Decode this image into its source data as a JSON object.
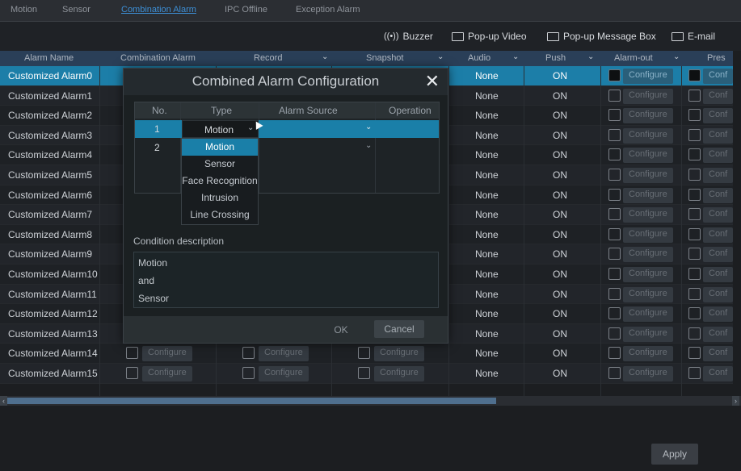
{
  "tabs": [
    {
      "label": "Motion",
      "active": false
    },
    {
      "label": "Sensor",
      "active": false
    },
    {
      "label": "Combination Alarm",
      "active": true
    },
    {
      "label": "IPC Offline",
      "active": false
    },
    {
      "label": "Exception Alarm",
      "active": false
    }
  ],
  "toolbar": {
    "buzzer": "Buzzer",
    "popup_video": "Pop-up Video",
    "popup_message": "Pop-up Message Box",
    "email": "E-mail"
  },
  "columns": {
    "alarm_name": "Alarm Name",
    "combination_alarm": "Combination Alarm",
    "record": "Record",
    "snapshot": "Snapshot",
    "audio": "Audio",
    "push": "Push",
    "alarm_out": "Alarm-out",
    "preset": "Pres"
  },
  "rows": [
    {
      "name": "Customized Alarm0",
      "audio": "None",
      "push": "ON"
    },
    {
      "name": "Customized Alarm1",
      "audio": "None",
      "push": "ON"
    },
    {
      "name": "Customized Alarm2",
      "audio": "None",
      "push": "ON"
    },
    {
      "name": "Customized Alarm3",
      "audio": "None",
      "push": "ON"
    },
    {
      "name": "Customized Alarm4",
      "audio": "None",
      "push": "ON"
    },
    {
      "name": "Customized Alarm5",
      "audio": "None",
      "push": "ON"
    },
    {
      "name": "Customized Alarm6",
      "audio": "None",
      "push": "ON"
    },
    {
      "name": "Customized Alarm7",
      "audio": "None",
      "push": "ON"
    },
    {
      "name": "Customized Alarm8",
      "audio": "None",
      "push": "ON"
    },
    {
      "name": "Customized Alarm9",
      "audio": "None",
      "push": "ON"
    },
    {
      "name": "Customized Alarm10",
      "audio": "None",
      "push": "ON"
    },
    {
      "name": "Customized Alarm11",
      "audio": "None",
      "push": "ON"
    },
    {
      "name": "Customized Alarm12",
      "audio": "None",
      "push": "ON"
    },
    {
      "name": "Customized Alarm13",
      "audio": "None",
      "push": "ON"
    },
    {
      "name": "Customized Alarm14",
      "audio": "None",
      "push": "ON"
    },
    {
      "name": "Customized Alarm15",
      "audio": "None",
      "push": "ON"
    }
  ],
  "configure_label": "Configure",
  "configure_truncated": "Conf",
  "apply_label": "Apply",
  "modal": {
    "title": "Combined Alarm Configuration",
    "close": "✕",
    "columns": {
      "no": "No.",
      "type": "Type",
      "alarm_source": "Alarm Source",
      "operation": "Operation"
    },
    "rows": [
      {
        "no": "1",
        "type": "Motion"
      },
      {
        "no": "2",
        "type": ""
      }
    ],
    "dropdown_options": [
      "Motion",
      "Sensor",
      "Face Recognition",
      "Intrusion",
      "Line Crossing"
    ],
    "condition_label": "Condition description",
    "condition_lines": [
      "Motion",
      "and",
      "Sensor"
    ],
    "ok_label": "OK",
    "cancel_label": "Cancel"
  },
  "colors": {
    "accent": "#1a7fa8",
    "header_bg": "#2a3f58",
    "active_tab": "#3d8fd6"
  }
}
